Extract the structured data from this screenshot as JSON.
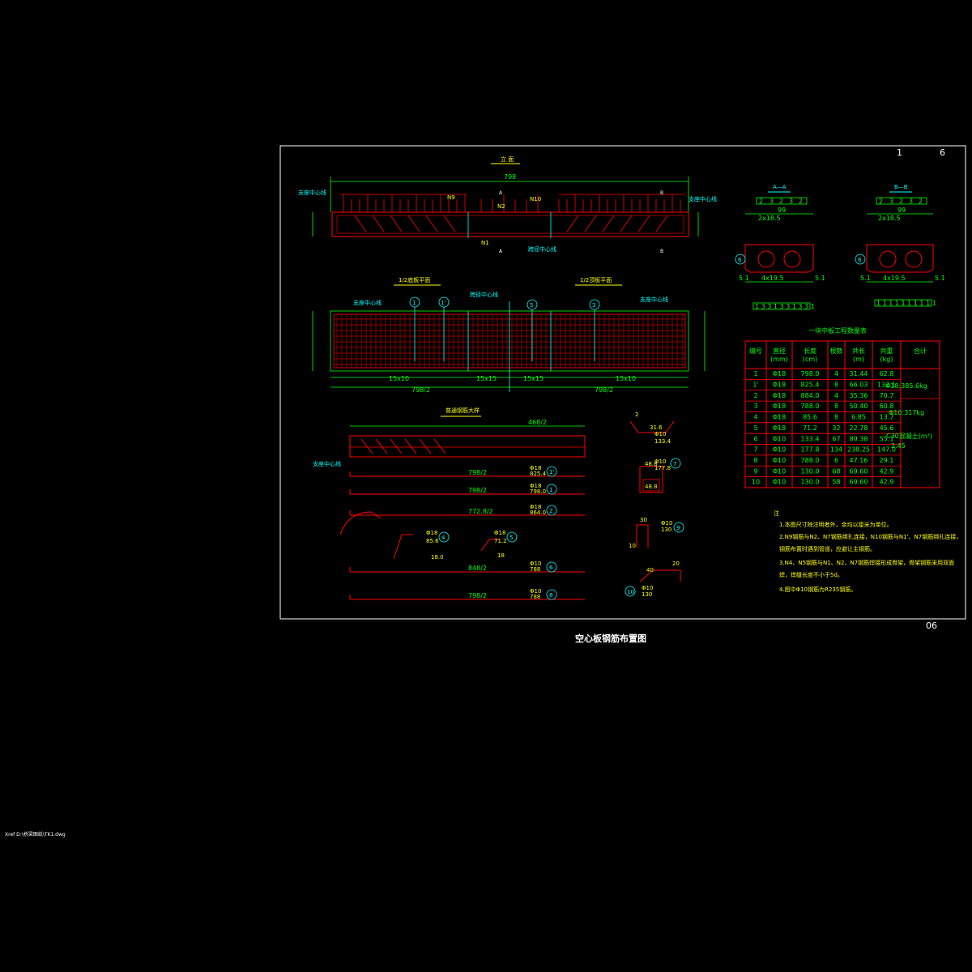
{
  "sheet": {
    "page_numbers": [
      "1",
      "6"
    ],
    "drawing_no": "06",
    "title": "空心板钢筋布置图",
    "xref_path": "Xref D:\\桥梁图纸\\TK1.dwg"
  },
  "elevation": {
    "title": "立 面",
    "total_dim": "798",
    "labels": {
      "support_left": "支座中心线",
      "support_right": "支座中心线",
      "span_center": "跨径中心线",
      "n9": "N9",
      "n10": "N10",
      "n2": "N2",
      "n1": "N1",
      "sec_a": "A",
      "sec_b": "B"
    }
  },
  "plan": {
    "title_left": "1/2底板平面",
    "title_right": "1/2顶板平面",
    "support_left": "支座中心线",
    "support_right": "支座中心线",
    "span_center": "跨径中心线",
    "dims": [
      "15x10",
      "15x15",
      "15x15",
      "15x10"
    ],
    "half_left": "798/2",
    "half_right": "798/2",
    "circles": [
      "1",
      "1'",
      "5",
      "3"
    ]
  },
  "end_detail": {
    "title": "普通钢筋大样",
    "top_dim": "468/2",
    "support": "支座中心线",
    "bars": [
      {
        "mark": "1'",
        "dia": "Φ18",
        "len": "825.4",
        "span": "798/2"
      },
      {
        "mark": "1",
        "dia": "Φ18",
        "len": "798.0",
        "span": "798/2"
      },
      {
        "mark": "2",
        "dia": "Φ18",
        "len": "864.0",
        "span": "772.8/2"
      },
      {
        "mark": "6",
        "dia": "Φ10",
        "len": "788",
        "span": "848/2"
      },
      {
        "mark": "8",
        "dia": "Φ10",
        "len": "788",
        "span": "798/2"
      }
    ],
    "bent_bars": [
      {
        "mark": "4",
        "dia": "Φ18",
        "len": "85.6",
        "extra": "18.0"
      },
      {
        "mark": "5",
        "dia": "Φ18",
        "len": "71.2",
        "extra": "18"
      }
    ],
    "stirrups": [
      {
        "mark": "7",
        "dia": "Φ10",
        "len": "177.8",
        "a": "48.8",
        "b": "48.8"
      },
      {
        "mark": "9",
        "dia": "Φ10",
        "len": "130",
        "a": "30",
        "b": "10"
      },
      {
        "mark": "10",
        "dia": "Φ10",
        "len": "130",
        "a": "40",
        "b": "20"
      },
      {
        "mark": "2a",
        "dia": "Φ10",
        "len": "133.4",
        "a": "31.6",
        "b": "2"
      }
    ]
  },
  "section_aa": {
    "title": "A—A",
    "top_dims": [
      "2",
      "3",
      "2",
      "3",
      "2"
    ],
    "width": "99",
    "inner": "2x18.5",
    "mark": "6",
    "bottom_dims": [
      "5.1",
      "4x19.5",
      "5.1"
    ],
    "bottom_grid": "1 3 3 1 3 3 1 3 3 1"
  },
  "section_bb": {
    "title": "B—B",
    "top_dims": [
      "2",
      "3",
      "2",
      "3",
      "2"
    ],
    "width": "99",
    "inner": "2x18.5",
    "mark": "6",
    "bottom_dims": [
      "5.1",
      "4x19.5",
      "5.1"
    ],
    "bottom_grid": "1 1 1 1 1 1 1 1 1 1"
  },
  "quantities": {
    "title": "一块中板工程数量表",
    "headers": [
      "编号",
      "直径\n(mm)",
      "长度\n(cm)",
      "根数",
      "共长\n(m)",
      "共重\n(kg)",
      "合计"
    ],
    "rows": [
      [
        "1",
        "Φ18",
        "798.0",
        "4",
        "31.44",
        "62.8"
      ],
      [
        "1'",
        "Φ18",
        "825.4",
        "8",
        "66.03",
        "132.1"
      ],
      [
        "2",
        "Φ18",
        "884.0",
        "4",
        "35.36",
        "70.7"
      ],
      [
        "3",
        "Φ18",
        "788.0",
        "8",
        "50.40",
        "60.8"
      ],
      [
        "4",
        "Φ18",
        "85.6",
        "8",
        "6.85",
        "13.7"
      ],
      [
        "5",
        "Φ18",
        "71.2",
        "32",
        "22.78",
        "45.6"
      ],
      [
        "6",
        "Φ10",
        "133.4",
        "67",
        "89.38",
        "55.1"
      ],
      [
        "7",
        "Φ10",
        "177.8",
        "134",
        "238.25",
        "147.0"
      ],
      [
        "8",
        "Φ10",
        "788.0",
        "6",
        "47.16",
        "29.1"
      ],
      [
        "9",
        "Φ10",
        "130.0",
        "68",
        "69.60",
        "42.9"
      ],
      [
        "10",
        "Φ10",
        "130.0",
        "58",
        "69.60",
        "42.9"
      ]
    ],
    "totals": [
      "Φ18:385.6kg",
      "Φ10:317kg",
      "C30混凝土(m³)",
      "2.45"
    ]
  },
  "notes": {
    "heading": "注",
    "items": [
      "1.本图尺寸除注明者外，余均以厘米为单位。",
      "2.N9钢筋与N2、N7钢筋绑扎连接，N10钢筋与N1'、N7钢筋绑扎连接，",
      "  钢筋布置时遇到管道，应避让主钢筋。",
      "3.N4、N5钢筋与N1、N2、N7钢筋焊接形成骨架，骨架钢筋采用双面",
      "  焊，焊缝长度不小于5d。",
      "4.图中Φ10钢筋为R235钢筋。"
    ]
  },
  "colors": {
    "background": "#000000",
    "frame": "#ffffff",
    "rebar": "#ff0000",
    "dimension": "#00ff00",
    "title": "#ffff00",
    "label": "#00ffff",
    "bar_mark": "#ff00ff"
  }
}
